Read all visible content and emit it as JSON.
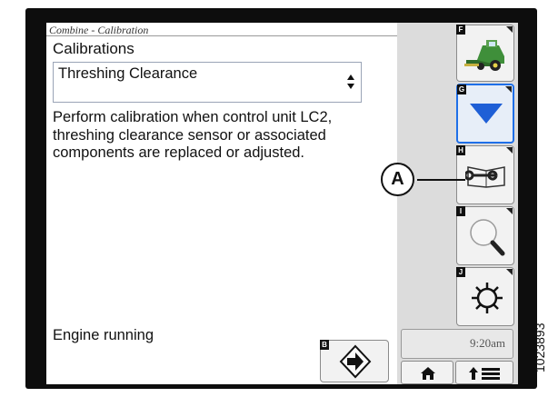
{
  "window": {
    "title": "Combine - Calibration"
  },
  "section": {
    "title": "Calibrations"
  },
  "dropdown": {
    "selected": "Threshing Clearance"
  },
  "description": "Perform calibration when control unit LC2, threshing clearance sensor or associated components are replaced or adjusted.",
  "status": {
    "text": "Engine running"
  },
  "time": "9:20am",
  "softkeys": {
    "f": {
      "letter": "F",
      "icon": "combine-icon"
    },
    "g": {
      "letter": "G",
      "icon": "down-arrow-icon"
    },
    "h": {
      "letter": "H",
      "icon": "wrench-book-icon"
    },
    "i": {
      "letter": "I",
      "icon": "magnifier-icon"
    },
    "j": {
      "letter": "J",
      "icon": "gear-icon"
    },
    "b": {
      "letter": "B",
      "icon": "enter-arrow-icon"
    }
  },
  "callout": {
    "label": "A"
  },
  "reference_number": "1023893",
  "colors": {
    "selection_blue": "#1f6fe8",
    "bezel": "#0d0d0d",
    "panel_gray": "#dcdcdc"
  }
}
